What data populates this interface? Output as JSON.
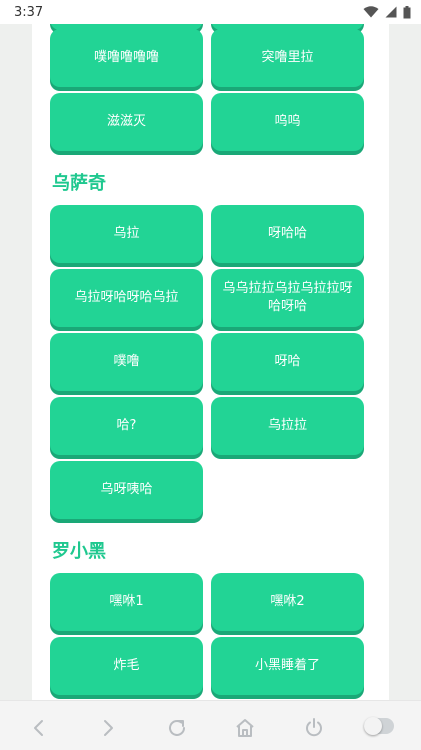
{
  "status_bar": {
    "time": "3:37"
  },
  "sections": [
    {
      "title": "乌萨奇",
      "buttons": [
        "乌拉",
        "呀哈哈",
        "乌拉呀哈呀哈乌拉",
        "乌乌拉拉乌拉乌拉拉呀哈呀哈",
        "噗噜",
        "呀哈",
        "哈?",
        "乌拉拉",
        "乌呀咦哈"
      ]
    },
    {
      "title": "罗小黑",
      "buttons": [
        "嘿咻1",
        "嘿咻2",
        "炸毛",
        "小黑睡着了"
      ]
    }
  ],
  "top_buttons": [
    "噗噜噜噜噜",
    "突噜里拉",
    "滋滋灭",
    "呜呜"
  ],
  "accent_color": "#22d495",
  "nav": {
    "icons": [
      "back-icon",
      "forward-icon",
      "refresh-icon",
      "home-icon",
      "power-icon",
      "toggle-switch"
    ]
  }
}
